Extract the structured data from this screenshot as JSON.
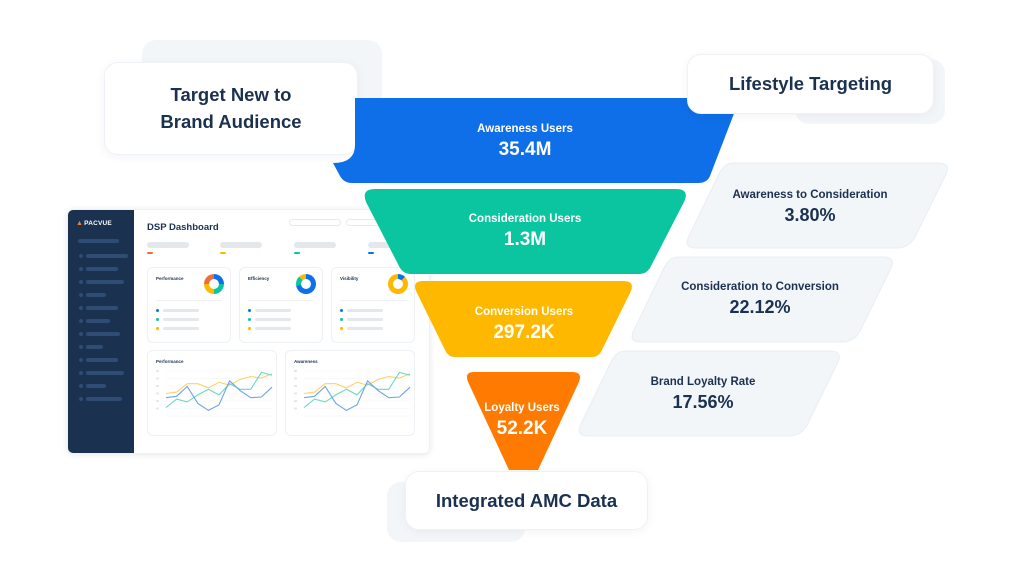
{
  "callouts": {
    "target_new": "Target New to Brand Audience",
    "target_new_line1": "Target New to",
    "target_new_line2": "Brand Audience",
    "lifestyle": "Lifestyle Targeting",
    "amc": "Integrated AMC Data"
  },
  "funnel": {
    "stages": [
      {
        "label": "Awareness Users",
        "value": "35.4M",
        "color": "#0f6fe8"
      },
      {
        "label": "Consideration Users",
        "value": "1.3M",
        "color": "#0ac5a0"
      },
      {
        "label": "Conversion Users",
        "value": "297.2K",
        "color": "#ffb800"
      },
      {
        "label": "Loyalty Users",
        "value": "52.2K",
        "color": "#ff7a00"
      }
    ]
  },
  "rates": [
    {
      "label": "Awareness to Consideration",
      "value": "3.80%"
    },
    {
      "label": "Consideration to Conversion",
      "value": "22.12%"
    },
    {
      "label": "Brand Loyalty Rate",
      "value": "17.56%"
    }
  ],
  "dashboard": {
    "brand": "PACVUE",
    "title": "DSP Dashboard",
    "stat_colors": [
      "#f26b3a",
      "#ffb800",
      "#0ac5a0",
      "#0f6fe8"
    ],
    "cards": [
      {
        "title": "Performance",
        "donut": "performance"
      },
      {
        "title": "Efficiency",
        "donut": "efficiency"
      },
      {
        "title": "Visibility",
        "donut": "visibility"
      }
    ],
    "legend_colors": [
      "#0f6fe8",
      "#0ac5a0",
      "#ffb800"
    ],
    "charts": [
      {
        "title": "Performance"
      },
      {
        "title": "Awareness"
      }
    ],
    "line_series": {
      "yellow": [
        3.2,
        3.4,
        4.6,
        4.6,
        4.0,
        4.8,
        4.4,
        5.2,
        5.6,
        5.4,
        6.0
      ],
      "green": [
        1.2,
        2.4,
        2.0,
        3.0,
        3.8,
        3.0,
        4.6,
        3.8,
        3.8,
        6.2,
        5.8
      ],
      "blue": [
        2.6,
        2.8,
        4.2,
        1.8,
        0.8,
        1.6,
        5.0,
        3.6,
        2.6,
        2.7,
        4.1
      ]
    },
    "line_colors": {
      "yellow": "#ffd166",
      "green": "#6fd8c0",
      "blue": "#6ea2ee"
    }
  }
}
